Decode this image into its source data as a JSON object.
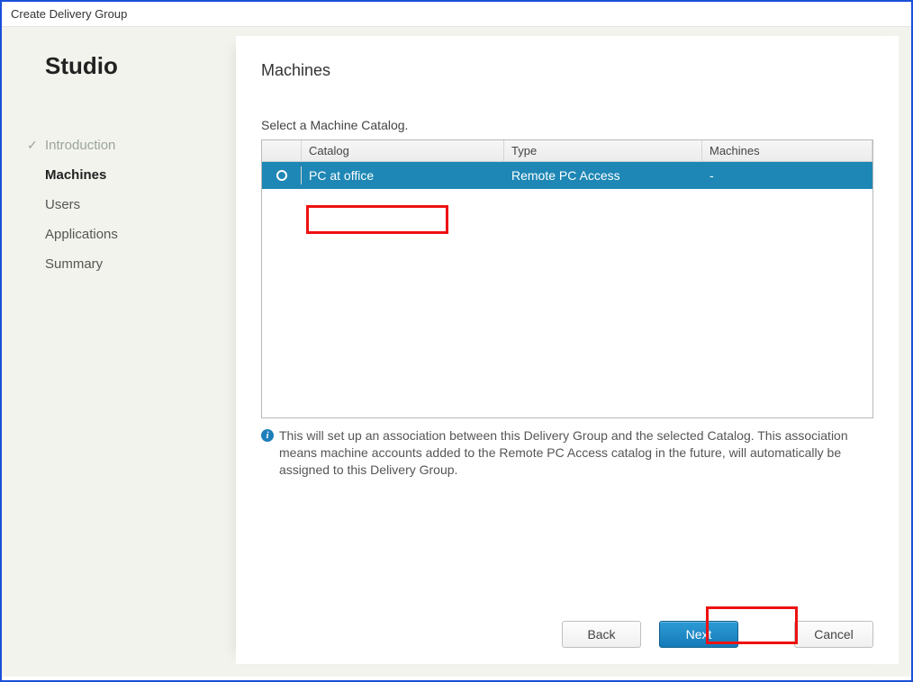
{
  "window": {
    "title": "Create Delivery Group"
  },
  "brand": "Studio",
  "steps": [
    {
      "label": "Introduction",
      "state": "done"
    },
    {
      "label": "Machines",
      "state": "current"
    },
    {
      "label": "Users",
      "state": ""
    },
    {
      "label": "Applications",
      "state": ""
    },
    {
      "label": "Summary",
      "state": ""
    }
  ],
  "main": {
    "heading": "Machines",
    "prompt": "Select a Machine Catalog.",
    "columns": {
      "catalog": "Catalog",
      "type": "Type",
      "machines": "Machines"
    },
    "rows": [
      {
        "catalog": "PC at office",
        "type": "Remote PC Access",
        "machines": "-"
      }
    ],
    "info": "This will set up an association between this Delivery Group and the selected Catalog. This association means machine accounts added to the Remote PC Access catalog in the future, will automatically be assigned to this Delivery Group."
  },
  "buttons": {
    "back": "Back",
    "next": "Next",
    "cancel": "Cancel"
  }
}
